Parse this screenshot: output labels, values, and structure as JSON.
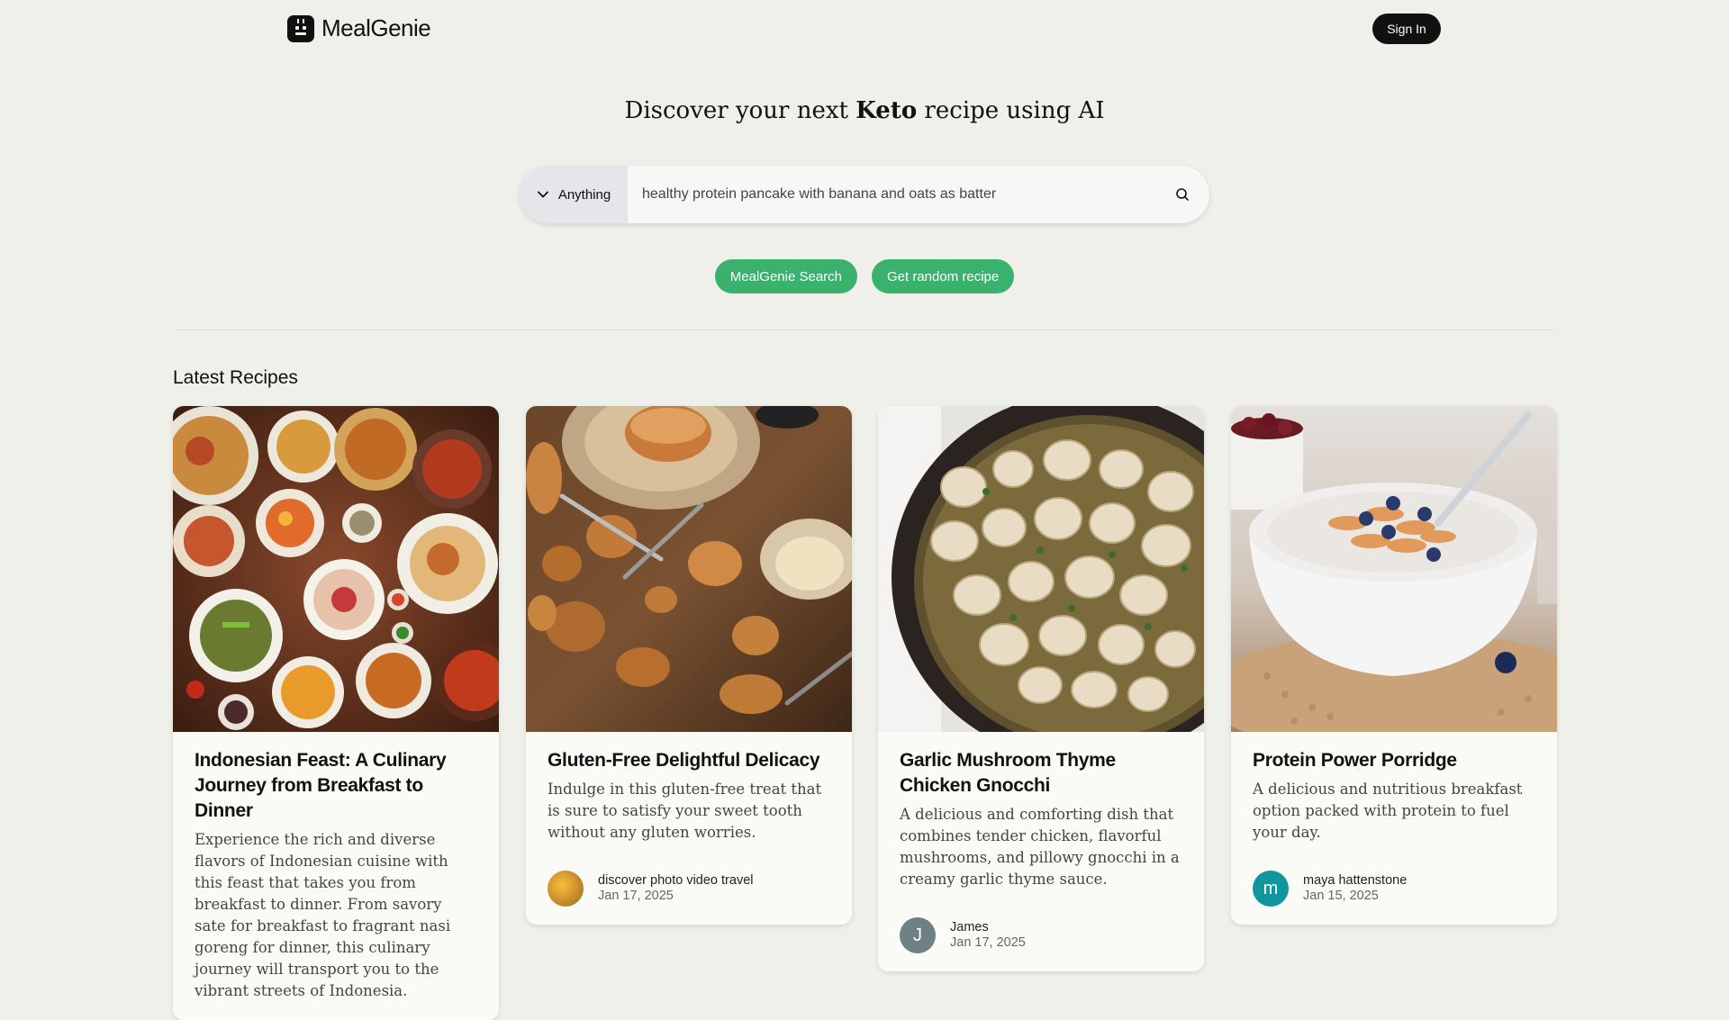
{
  "header": {
    "brand": "MealGenie",
    "sign_in_label": "Sign In"
  },
  "hero": {
    "title_prefix": "Discover your next ",
    "title_emphasis": "Keto",
    "title_suffix": " recipe using AI"
  },
  "search": {
    "filter_label": "Anything",
    "query": "healthy protein pancake with banana and oats as batter"
  },
  "actions": {
    "search_label": "MealGenie Search",
    "random_label": "Get random recipe"
  },
  "latest": {
    "heading": "Latest Recipes",
    "recipes": [
      {
        "title": "Indonesian Feast: A Culinary Journey from Breakfast to Dinner",
        "description": "Experience the rich and diverse flavors of Indonesian cuisine with this feast that takes you from breakfast to dinner. From savory sate for breakfast to fragrant nasi goreng for dinner, this culinary journey will transport you to the vibrant streets of Indonesia.",
        "author": "",
        "date": ""
      },
      {
        "title": "Gluten-Free Delightful Delicacy",
        "description": "Indulge in this gluten-free treat that is sure to satisfy your sweet tooth without any gluten worries.",
        "author": "discover photo video travel",
        "date": "Jan 17, 2025",
        "avatar_letter": ""
      },
      {
        "title": "Garlic Mushroom Thyme Chicken Gnocchi",
        "description": "A delicious and comforting dish that combines tender chicken, flavorful mushrooms, and pillowy gnocchi in a creamy garlic thyme sauce.",
        "author": "James",
        "date": "Jan 17, 2025",
        "avatar_letter": "J",
        "avatar_color": "#6e7f86"
      },
      {
        "title": "Protein Power Porridge",
        "description": "A delicious and nutritious breakfast option packed with protein to fuel your day.",
        "author": "maya hattenstone",
        "date": "Jan 15, 2025",
        "avatar_letter": "m",
        "avatar_color": "#0f97a0"
      }
    ]
  },
  "colors": {
    "background": "#f0f0ea",
    "accent_green": "#3ab26e",
    "dark": "#111111"
  }
}
